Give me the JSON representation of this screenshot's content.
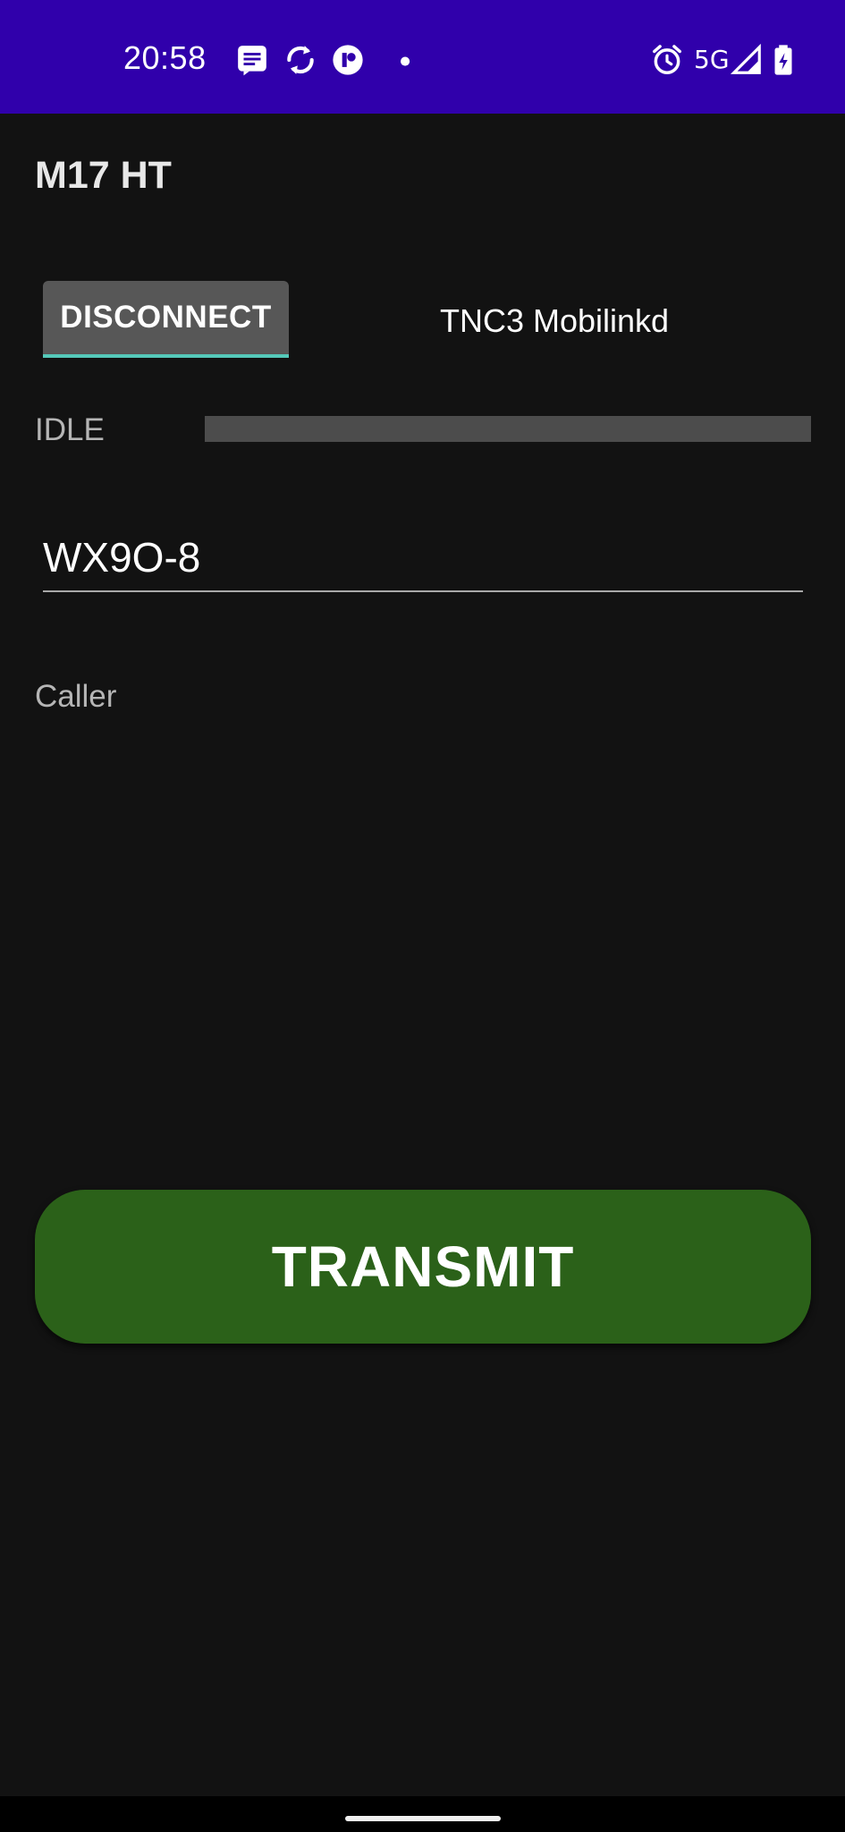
{
  "status_bar": {
    "time": "20:58",
    "network": "5G",
    "icons": [
      "messages-icon",
      "sync-icon",
      "app-notification-icon",
      "dot-icon",
      "alarm-icon",
      "signal-icon",
      "battery-charging-icon"
    ]
  },
  "app": {
    "title": "M17 HT"
  },
  "connection": {
    "disconnect_label": "DISCONNECT",
    "device_name": "TNC3 Mobilinkd"
  },
  "status": {
    "label": "IDLE",
    "level": 0
  },
  "callsign": {
    "value": "WX9O-8"
  },
  "caller": {
    "label": "Caller"
  },
  "transmit": {
    "label": "TRANSMIT"
  },
  "colors": {
    "status_bar": "#3000ab",
    "background": "#121212",
    "transmit": "#2b6119",
    "accent": "#55c9b9"
  }
}
